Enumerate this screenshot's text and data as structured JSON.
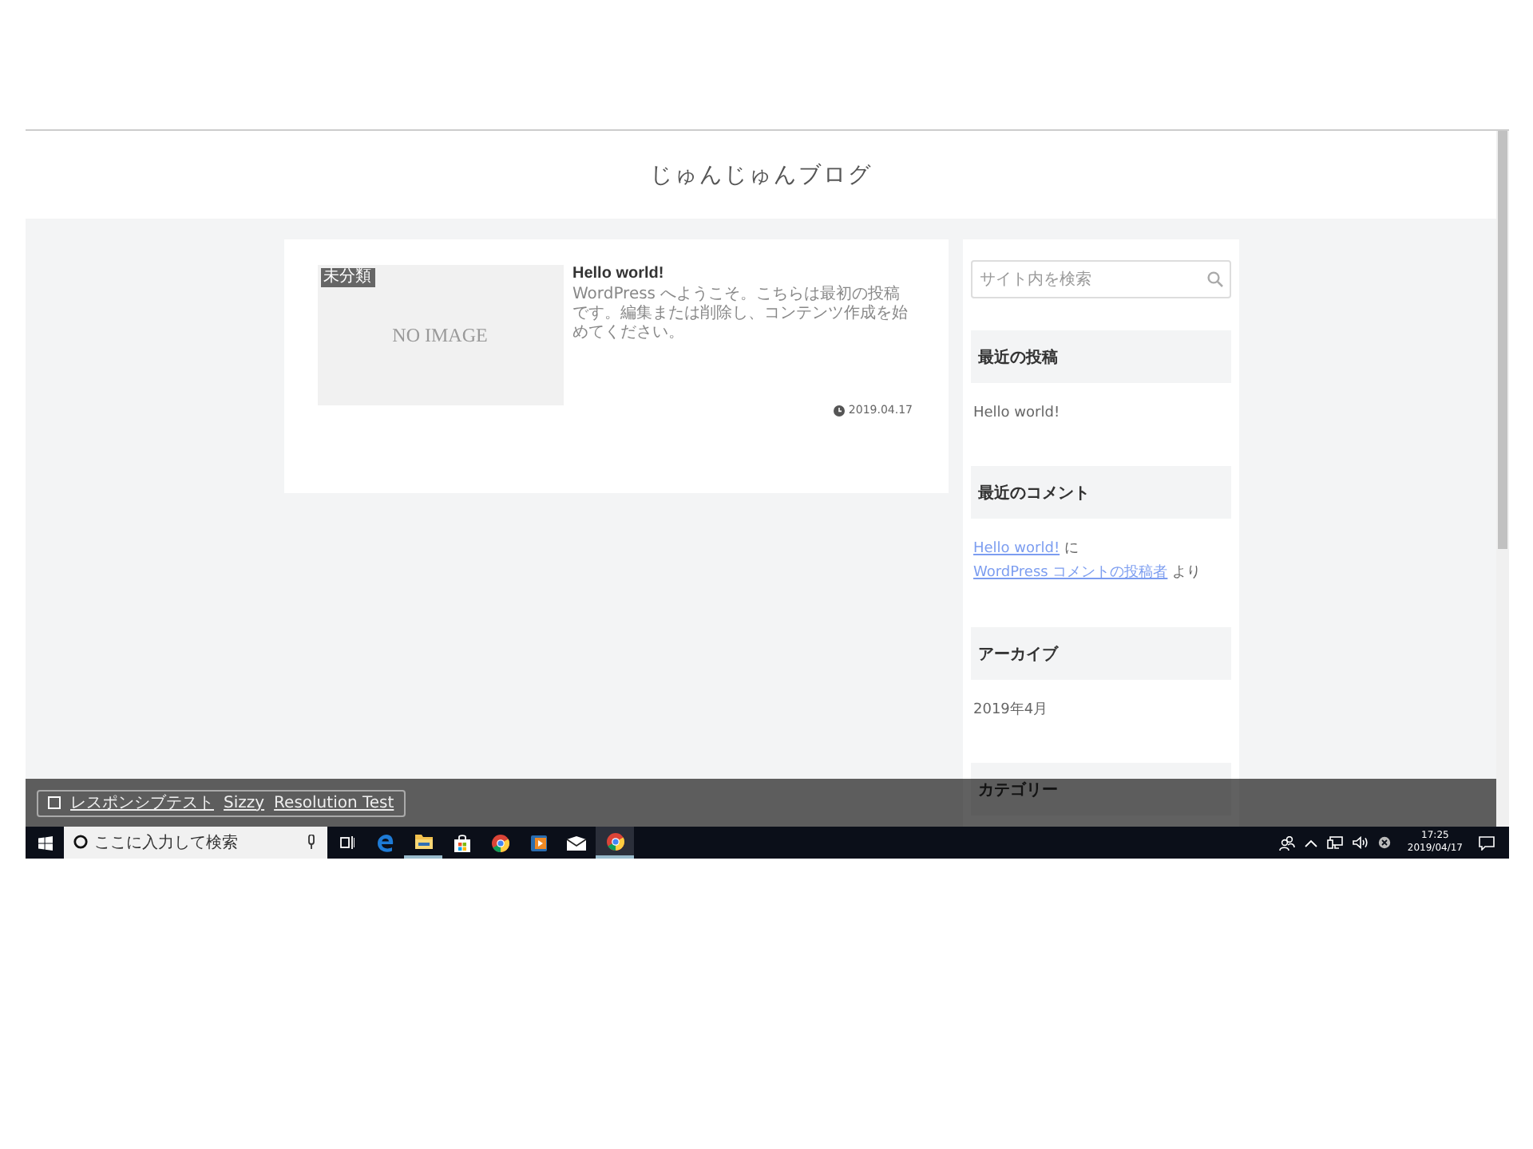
{
  "blog": {
    "title": "じゅんじゅんブログ"
  },
  "posts": [
    {
      "category": "未分類",
      "image_text": "NO IMAGE",
      "title": "Hello world!",
      "excerpt": "WordPress へようこそ。こちらは最初の投稿です。編集または削除し、コンテンツ作成を始めてください。",
      "date": "2019.04.17"
    }
  ],
  "sidebar": {
    "search": {
      "placeholder": "サイト内を検索"
    },
    "widgets": [
      {
        "kind": "list",
        "title": "最近の投稿",
        "items": [
          "Hello world!"
        ]
      },
      {
        "kind": "comment",
        "title": "最近のコメント",
        "parts": [
          {
            "text": "Hello world!",
            "link": true
          },
          {
            "text": "に",
            "link": false
          },
          {
            "text": "WordPress コメントの投稿者",
            "link": true
          },
          {
            "text": "より",
            "link": false
          }
        ]
      },
      {
        "kind": "list",
        "title": "アーカイブ",
        "items": [
          "2019年4月"
        ]
      },
      {
        "kind": "heading",
        "title": "カテゴリー"
      }
    ]
  },
  "test_bar": {
    "checked": false,
    "links": [
      "レスポンシブテスト",
      "Sizzy",
      "Resolution Test"
    ]
  },
  "taskbar": {
    "search": {
      "placeholder": "ここに入力して検索"
    },
    "apps": [
      {
        "kind": "edge",
        "active": false,
        "running": false
      },
      {
        "kind": "folder",
        "active": false,
        "running": true
      },
      {
        "kind": "store",
        "active": false,
        "running": false
      },
      {
        "kind": "chrome",
        "active": false,
        "running": false
      },
      {
        "kind": "media",
        "active": false,
        "running": false
      },
      {
        "kind": "mail",
        "active": false,
        "running": false
      },
      {
        "kind": "chrome",
        "active": true,
        "running": true
      }
    ],
    "time": "17:25",
    "date": "2019/04/17"
  }
}
